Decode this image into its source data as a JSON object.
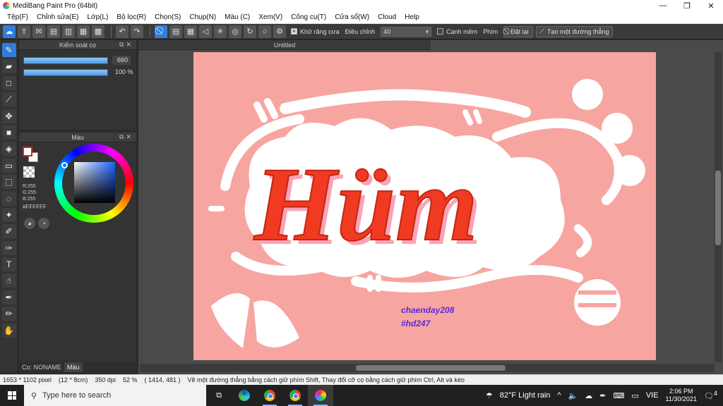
{
  "window": {
    "title": "MediBang Paint Pro (64bit)",
    "minimize": "—",
    "maximize": "❐",
    "close": "✕"
  },
  "menu": [
    "Tệp(F)",
    "Chỉnh sửa(E)",
    "Lớp(L)",
    "Bộ lọc(R)",
    "Chọn(S)",
    "Chụp(N)",
    "Màu (C)",
    "Xem(V)",
    "Công cụ(T)",
    "Cửa sổ(W)",
    "Cloud",
    "Help"
  ],
  "toolbar": {
    "antialias_label": "Khử răng cưa",
    "adjust_label": "Điều chỉnh",
    "adjust_value": "40",
    "edge_label": "Cạnh mềm",
    "key_label": "Phím",
    "reset_label": "Đặt lại",
    "line_label": "Tạo một đường thẳng"
  },
  "brush_panel": {
    "title": "Kiểm soát cọ",
    "size_value": "660",
    "opacity_value": "100 %"
  },
  "color_panel": {
    "title": "Màu",
    "r": "R:255",
    "g": "G:255",
    "b": "B:255",
    "hex": "#FFFFFF"
  },
  "panel_tabs": [
    "Co: NONAME",
    "Màu"
  ],
  "document": {
    "tab": "Untitled"
  },
  "artwork": {
    "word": "Hüm",
    "credit1": "chaenday208",
    "credit2": "#hd247",
    "bg_color": "#f7a5a1",
    "letter_color": "#f03a22"
  },
  "status": {
    "size": "1653 * 1102 pixel",
    "cm": "(12 * 8cm)",
    "dpi": "350 dpi",
    "zoom": "52 %",
    "coords": "( 1414, 481 )",
    "hint": "Vẽ một đường thẳng bằng cách giữ phím Shift, Thay đổi cỡ cọ bằng cách giữ phím Ctrl, Alt và kéo"
  },
  "taskbar": {
    "search_placeholder": "Type here to search",
    "weather": "82°F  Light rain",
    "lang": "VIE",
    "time": "2:06 PM",
    "date": "11/30/2021",
    "notif": "4"
  }
}
